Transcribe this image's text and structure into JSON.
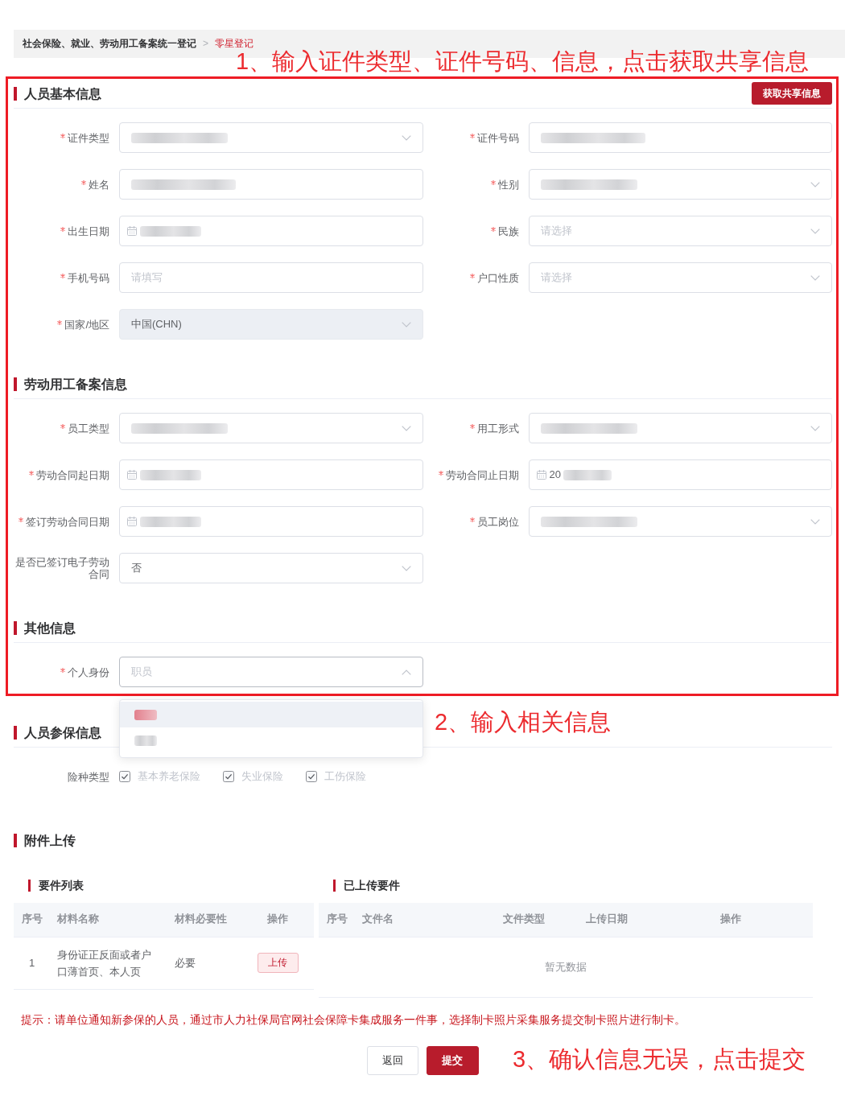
{
  "breadcrumb": {
    "items": [
      {
        "label": "社会保险、就业、劳动用工备案统一登记",
        "current": false
      },
      {
        "label": "零星登记",
        "current": true
      }
    ],
    "separator": ">"
  },
  "highlight_frame": {
    "sections": [
      {
        "title": "人员基本信息",
        "action": "获取共享信息",
        "fields": [
          {
            "label": "证件类型",
            "kind": "select",
            "required": true,
            "disabled": false,
            "redacted": true,
            "open": false
          },
          {
            "label": "证件号码",
            "kind": "text",
            "required": true,
            "disabled": false,
            "redacted": true
          },
          {
            "label": "姓名",
            "kind": "text",
            "required": true,
            "disabled": false,
            "redacted": true
          },
          {
            "label": "性别",
            "kind": "select",
            "required": true,
            "disabled": false,
            "redacted": true,
            "open": false
          },
          {
            "label": "出生日期",
            "kind": "date",
            "required": true,
            "disabled": false,
            "redacted": true
          },
          {
            "label": "民族",
            "kind": "select",
            "required": true,
            "disabled": false,
            "redacted": false,
            "open": false,
            "placeholder": "请选择"
          },
          {
            "label": "手机号码",
            "kind": "text",
            "required": true,
            "disabled": false,
            "redacted": false,
            "placeholder": "请填写"
          },
          {
            "label": "户口性质",
            "kind": "select",
            "required": true,
            "disabled": false,
            "redacted": false,
            "open": false,
            "placeholder": "请选择"
          },
          {
            "label": "国家/地区",
            "kind": "select",
            "required": true,
            "disabled": true,
            "redacted": false,
            "open": false,
            "value": "中国(CHN)"
          }
        ]
      },
      {
        "title": "劳动用工备案信息",
        "fields": [
          {
            "label": "员工类型",
            "kind": "select",
            "required": true,
            "disabled": false,
            "redacted": true,
            "open": false
          },
          {
            "label": "用工形式",
            "kind": "select",
            "required": true,
            "disabled": false,
            "redacted": true,
            "open": false
          },
          {
            "label": "劳动合同起日期",
            "kind": "date",
            "required": true,
            "disabled": false,
            "redacted": true
          },
          {
            "label": "劳动合同止日期",
            "kind": "date",
            "required": true,
            "disabled": false,
            "redacted": true,
            "value": "20"
          },
          {
            "label": "签订劳动合同日期",
            "kind": "date",
            "required": true,
            "disabled": false,
            "redacted": true
          },
          {
            "label": "员工岗位",
            "kind": "select",
            "required": true,
            "disabled": false,
            "redacted": true,
            "open": false
          },
          {
            "label": "是否已签订电子劳动合同",
            "kind": "select",
            "required": false,
            "disabled": false,
            "redacted": false,
            "open": false,
            "value": "否"
          }
        ]
      },
      {
        "title": "其他信息",
        "fields": [
          {
            "label": "个人身份",
            "kind": "select",
            "required": true,
            "disabled": false,
            "redacted": false,
            "open": true,
            "placeholder": "职员",
            "options": [
              {
                "selected": true,
                "highlighted": true,
                "redacted": true
              },
              {
                "selected": false,
                "highlighted": false,
                "redacted": true
              }
            ]
          }
        ]
      }
    ]
  },
  "sections": [
    {
      "title": "人员参保信息",
      "fields": [
        {
          "label": "险种类型",
          "kind": "checkboxes",
          "required": false,
          "options": [
            {
              "label": "基本养老保险",
              "checked": true,
              "disabled": true
            },
            {
              "label": "失业保险",
              "checked": true,
              "disabled": true
            },
            {
              "label": "工伤保险",
              "checked": true,
              "disabled": true
            }
          ]
        }
      ]
    },
    {
      "title": "附件上传",
      "panels": [
        {
          "title": "要件列表",
          "columns": [
            "序号",
            "材料名称",
            "材料必要性",
            "操作"
          ],
          "rows": [
            {
              "cells": [
                "1",
                "身份证正反面或者户口薄首页、本人页",
                "必要"
              ],
              "action": "上传"
            }
          ]
        },
        {
          "title": "已上传要件",
          "columns": [
            "序号",
            "文件名",
            "文件类型",
            "上传日期",
            "操作"
          ],
          "empty_text": "暂无数据"
        }
      ]
    }
  ],
  "tip": "提示：请单位通知新参保的人员，通过市人力社保局官网社会保障卡集成服务一件事，选择制卡照片采集服务提交制卡照片进行制卡。",
  "buttons": [
    {
      "label": "返回",
      "kind": "default"
    },
    {
      "label": "提交",
      "kind": "primary"
    }
  ],
  "annotations": [
    {
      "text": "1、输入证件类型、证件号码、信息，点击获取共享信息"
    },
    {
      "text": "2、输入相关信息"
    },
    {
      "text": "3、确认信息无误，点击提交"
    }
  ]
}
